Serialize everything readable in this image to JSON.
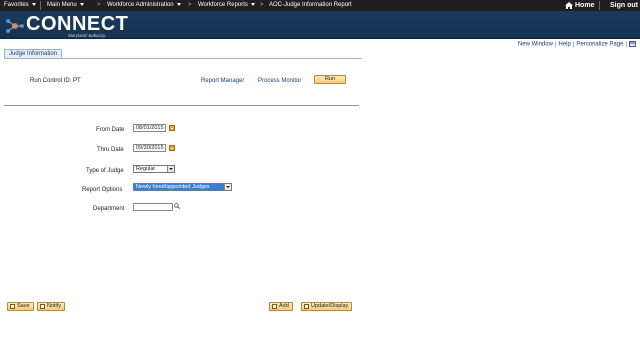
{
  "topnav": {
    "favorites": "Favorites",
    "main_menu": "Main Menu",
    "breadcrumb_sep": ">",
    "workforce_admin": "Workforce Administration",
    "workforce_reports": "Workforce Reports",
    "current_page": "AOC-Judge Information Report",
    "home": "Home",
    "sign_out": "Sign out"
  },
  "brand": {
    "name": "CONNECT",
    "sub": "Maryland Judiciary"
  },
  "utility": {
    "new_window": "New Window",
    "help": "Help",
    "personalize": "Personalize Page"
  },
  "tab": {
    "label": "Judge Information"
  },
  "run_control": {
    "label": "Run Control ID:",
    "value": "PT",
    "report_manager": "Report Manager",
    "process_monitor": "Process Monitor",
    "run_button": "Run"
  },
  "form": {
    "from_date_label": "From Date",
    "from_date_value": "08/01/2015",
    "thru_date_label": "Thru Date",
    "thru_date_value": "09/30/2015",
    "type_label": "Type of Judge",
    "type_value": "Regular",
    "report_options_label": "Report Options",
    "report_options_value": "Newly hired/appointed Judges",
    "department_label": "Department",
    "department_value": ""
  },
  "footer": {
    "save": "Save",
    "notify": "Notify",
    "add": "Add",
    "update_display": "Update/Display"
  },
  "colors": {
    "topbar": "#1f1f1f",
    "banner": "#1b3a5c",
    "link": "#1a3e73",
    "button": "#f5cc7a",
    "highlight_select": "#3a7ed6"
  }
}
